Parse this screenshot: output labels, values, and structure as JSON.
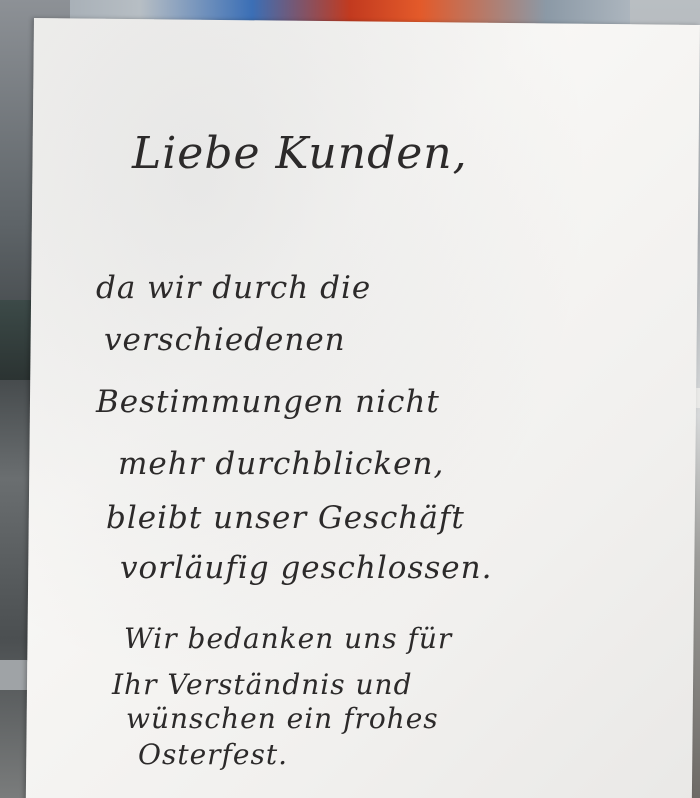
{
  "sign": {
    "greeting": "Liebe Kunden,",
    "paragraph1": [
      "da wir durch die",
      "verschiedenen",
      "Bestimmungen nicht",
      "mehr durchblicken,",
      "bleibt unser Geschäft",
      "vorläufig geschlossen."
    ],
    "paragraph2": [
      "Wir bedanken uns für",
      "Ihr Verständnis und",
      "wünschen ein frohes",
      "Osterfest."
    ]
  }
}
